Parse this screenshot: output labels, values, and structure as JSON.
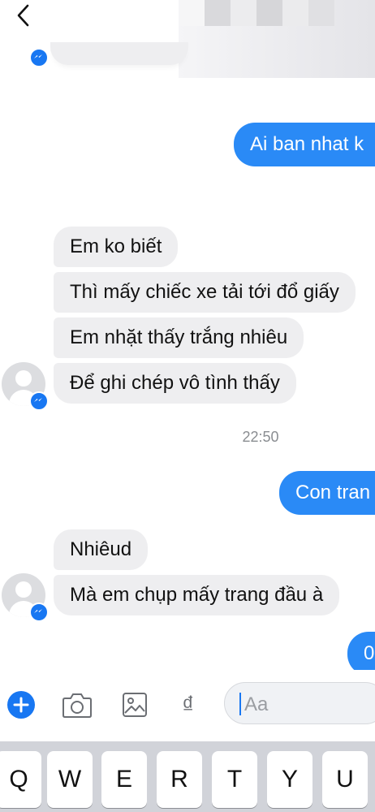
{
  "header": {
    "back_icon": "chevron-left-icon"
  },
  "conversation": {
    "outgoing_1": "Ai ban nhat k",
    "incoming_group_1": [
      "Em ko biết",
      "Thì mấy chiếc xe tải tới đổ giấy",
      "Em nhặt thấy trắng nhiêu",
      "Để ghi chép vô tình thấy"
    ],
    "timestamp": "22:50",
    "outgoing_2": "Con tran",
    "incoming_group_2": [
      "Nhiêud",
      "Mà em chụp mấy trang đầu à"
    ],
    "outgoing_3": "0"
  },
  "composer": {
    "placeholder": "Aa",
    "currency_symbol": "₫",
    "icons": [
      "plus-icon",
      "camera-icon",
      "gallery-icon",
      "currency-icon"
    ]
  },
  "keyboard": {
    "row1": [
      "Q",
      "W",
      "E",
      "R",
      "T",
      "Y",
      "U"
    ]
  },
  "colors": {
    "outgoing_bubble": "#2a8af6",
    "incoming_bubble": "#eeeef0",
    "accent": "#1877f2"
  }
}
